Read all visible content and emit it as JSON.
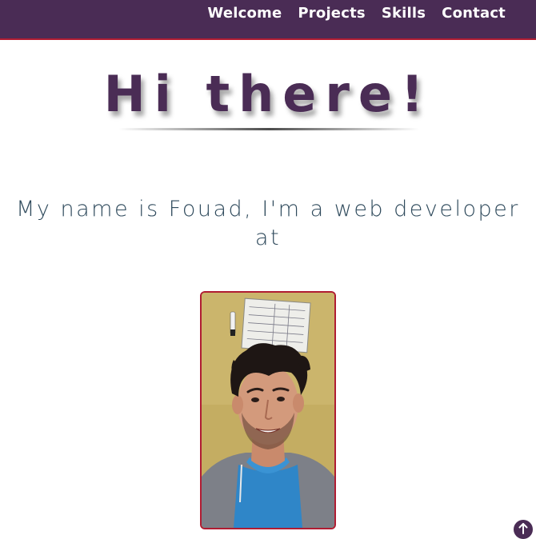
{
  "nav": {
    "items": [
      {
        "label": "Welcome"
      },
      {
        "label": "Projects"
      },
      {
        "label": "Skills"
      },
      {
        "label": "Contact"
      }
    ]
  },
  "hero": {
    "title": "Hi there!"
  },
  "intro": {
    "text": "My name is Fouad, I'm a web developer at"
  },
  "profile": {
    "photo_icon": "profile-photo"
  },
  "controls": {
    "back_to_top_icon": "arrow-up-icon"
  },
  "colors": {
    "brand": "#4a2c55",
    "accent": "#b01c32",
    "text": "#2f4a5c",
    "background": "#ffffff"
  }
}
